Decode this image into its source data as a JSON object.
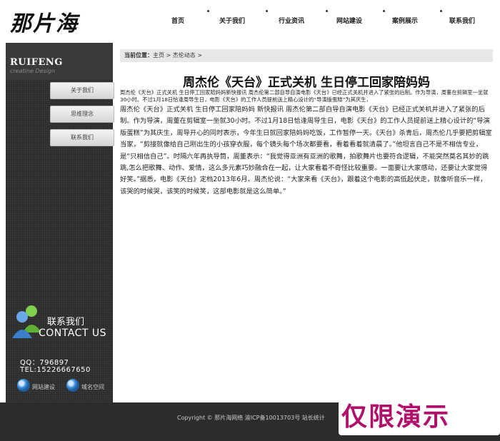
{
  "header": {
    "logo": "那片海",
    "nav": [
      "首页",
      "关于我们",
      "行业资讯",
      "网站建设",
      "案例展示",
      "联系我们"
    ]
  },
  "sidebar": {
    "brand": "RUIFENG",
    "brand_sub": "creatine Design",
    "buttons": [
      "关于我们",
      "思维理念",
      "联系我们"
    ],
    "contact_cn": "联系我们",
    "contact_en": "CONTACT US",
    "qq": "QQ：796897",
    "tel": "TEL:15226667650",
    "links": [
      "网站建设",
      "域名空间"
    ]
  },
  "breadcrumb": {
    "label": "当前位置：",
    "path": "主页 > 杰伦动态 >"
  },
  "article": {
    "title": "周杰伦《天台》正式关机 生日停工回家陪妈妈",
    "summary": "周杰伦《天台》正式关机 生日停工回家陪妈妈新快报讯 周杰伦第二部自导自演电影《天台》已经正式关机并进入了紧张的后制。作为导演，周董在剪辑室一坐就30小时。不过1月18日恰逢周导生日，电影《天台》的工作人员提前送上精心设计的“导演版蛋糕”为其庆生，",
    "body": "周杰伦《天台》正式关机 生日停工回家陪妈妈 新快报讯 周杰伦第二部自导自演电影《天台》已经正式关机并进入了紧张的后制。作为导演，周董在剪辑室一坐就30小时。不过1月18日恰逢周导生日，电影《天台》的工作人员提前送上精心设计的“导演版蛋糕”为其庆生，周导开心的同时表示，今年生日就回家陪妈妈吃饭，工作暂停一天。《天台》杀青后，周杰伦几乎要把剪辑室当家，“剪接就像给自己刚出生的小孩穿衣服，每个镜头每个场次都要看，看着看着就清晨了。”他坦言自己不是不相信专业，是“只相信自己”。时隔六年再执导筒，周董表示：“我觉得亚洲有亚洲的歌舞，拍歌舞片也要符合逻辑，不能突然莫名其妙的跳跳,怎么把歌舞、动作、爱情，这么多元素巧妙融合在一起，让大家看着不奇怪比较重要。一面要让大家感动，还要让大家觉得好笑。”据悉，电影《天台》定档2013年6月。周杰伦说：“大家来看《天台》，跟着这个电影的高低起伏走，就像听音乐一样，该哭的时候哭，该笑的时候笑，这部电影就是这么简单。”"
  },
  "footer": {
    "text": "Copyright ©  那片海网络   渝ICP备10013703号 站长统计"
  },
  "watermark": "仅限演示",
  "colors": {
    "sidebar_bg": "#2c2c2c",
    "watermark": "#b0106a",
    "breadcrumb_bg": "#e8e8e8"
  }
}
